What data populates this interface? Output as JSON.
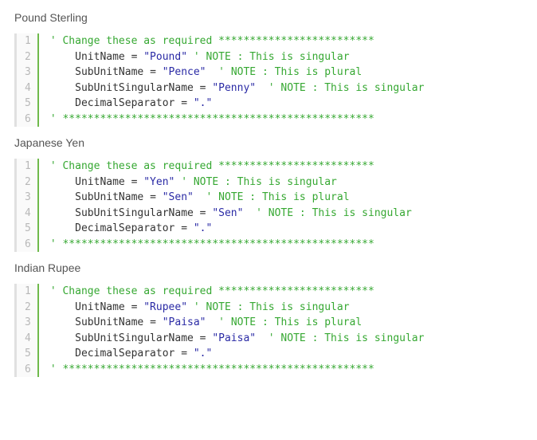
{
  "sections": [
    {
      "title": "Pound Sterling",
      "lines": [
        {
          "parts": [
            {
              "c": "comment",
              "t": "' Change these as required *************************"
            }
          ]
        },
        {
          "parts": [
            {
              "c": "identifier",
              "t": "    UnitName "
            },
            {
              "c": "op",
              "t": "= "
            },
            {
              "c": "string",
              "t": "\"Pound\" "
            },
            {
              "c": "comment",
              "t": "' NOTE : This is singular"
            }
          ]
        },
        {
          "parts": [
            {
              "c": "identifier",
              "t": "    SubUnitName "
            },
            {
              "c": "op",
              "t": "= "
            },
            {
              "c": "string",
              "t": "\"Pence\"  "
            },
            {
              "c": "comment",
              "t": "' NOTE : This is plural"
            }
          ]
        },
        {
          "parts": [
            {
              "c": "identifier",
              "t": "    SubUnitSingularName "
            },
            {
              "c": "op",
              "t": "= "
            },
            {
              "c": "string",
              "t": "\"Penny\"  "
            },
            {
              "c": "comment",
              "t": "' NOTE : This is singular"
            }
          ]
        },
        {
          "parts": [
            {
              "c": "identifier",
              "t": "    DecimalSeparator "
            },
            {
              "c": "op",
              "t": "= "
            },
            {
              "c": "string",
              "t": "\".\""
            }
          ]
        },
        {
          "parts": [
            {
              "c": "comment",
              "t": "' **************************************************"
            }
          ]
        }
      ]
    },
    {
      "title": "Japanese Yen",
      "lines": [
        {
          "parts": [
            {
              "c": "comment",
              "t": "' Change these as required *************************"
            }
          ]
        },
        {
          "parts": [
            {
              "c": "identifier",
              "t": "    UnitName "
            },
            {
              "c": "op",
              "t": "= "
            },
            {
              "c": "string",
              "t": "\"Yen\" "
            },
            {
              "c": "comment",
              "t": "' NOTE : This is singular"
            }
          ]
        },
        {
          "parts": [
            {
              "c": "identifier",
              "t": "    SubUnitName "
            },
            {
              "c": "op",
              "t": "= "
            },
            {
              "c": "string",
              "t": "\"Sen\"  "
            },
            {
              "c": "comment",
              "t": "' NOTE : This is plural"
            }
          ]
        },
        {
          "parts": [
            {
              "c": "identifier",
              "t": "    SubUnitSingularName "
            },
            {
              "c": "op",
              "t": "= "
            },
            {
              "c": "string",
              "t": "\"Sen\"  "
            },
            {
              "c": "comment",
              "t": "' NOTE : This is singular"
            }
          ]
        },
        {
          "parts": [
            {
              "c": "identifier",
              "t": "    DecimalSeparator "
            },
            {
              "c": "op",
              "t": "= "
            },
            {
              "c": "string",
              "t": "\".\""
            }
          ]
        },
        {
          "parts": [
            {
              "c": "comment",
              "t": "' **************************************************"
            }
          ]
        }
      ]
    },
    {
      "title": "Indian Rupee",
      "lines": [
        {
          "parts": [
            {
              "c": "comment",
              "t": "' Change these as required *************************"
            }
          ]
        },
        {
          "parts": [
            {
              "c": "identifier",
              "t": "    UnitName "
            },
            {
              "c": "op",
              "t": "= "
            },
            {
              "c": "string",
              "t": "\"Rupee\" "
            },
            {
              "c": "comment",
              "t": "' NOTE : This is singular"
            }
          ]
        },
        {
          "parts": [
            {
              "c": "identifier",
              "t": "    SubUnitName "
            },
            {
              "c": "op",
              "t": "= "
            },
            {
              "c": "string",
              "t": "\"Paisa\"  "
            },
            {
              "c": "comment",
              "t": "' NOTE : This is plural"
            }
          ]
        },
        {
          "parts": [
            {
              "c": "identifier",
              "t": "    SubUnitSingularName "
            },
            {
              "c": "op",
              "t": "= "
            },
            {
              "c": "string",
              "t": "\"Paisa\"  "
            },
            {
              "c": "comment",
              "t": "' NOTE : This is singular"
            }
          ]
        },
        {
          "parts": [
            {
              "c": "identifier",
              "t": "    DecimalSeparator "
            },
            {
              "c": "op",
              "t": "= "
            },
            {
              "c": "string",
              "t": "\".\""
            }
          ]
        },
        {
          "parts": [
            {
              "c": "comment",
              "t": "' **************************************************"
            }
          ]
        }
      ]
    }
  ]
}
